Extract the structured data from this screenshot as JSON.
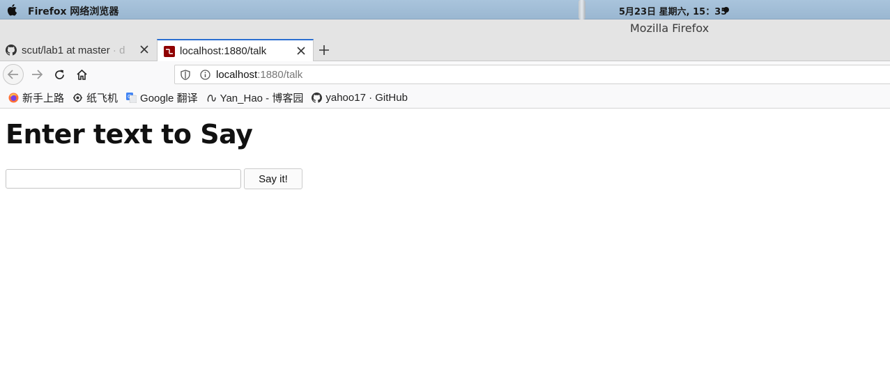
{
  "menubar": {
    "app_name": "Firefox 网络浏览器",
    "clock": "5月23日 星期六, 15：35"
  },
  "window": {
    "title": "Mozilla Firefox"
  },
  "tabs": [
    {
      "title": "scut/lab1 at master",
      "faded_suffix": " · d",
      "icon": "github-icon",
      "active": false
    },
    {
      "title": "localhost:1880/talk",
      "icon": "node-red-icon",
      "active": true
    }
  ],
  "urlbar": {
    "host": "localhost",
    "path": ":1880/talk"
  },
  "bookmarks": [
    {
      "label": "新手上路",
      "icon": "firefox-icon"
    },
    {
      "label": "纸飞机",
      "icon": "paper-plane-icon"
    },
    {
      "label": "Google 翻译",
      "icon": "google-translate-icon"
    },
    {
      "label": "Yan_Hao - 博客园",
      "icon": "cnblogs-icon"
    },
    {
      "label": "yahoo17 · GitHub",
      "icon": "github-icon"
    }
  ],
  "page": {
    "heading": "Enter text to Say",
    "input_value": "",
    "button_label": "Say it!"
  },
  "colors": {
    "menubar": "#a9c4dc",
    "active_tab_accent": "#2a6ed1"
  }
}
